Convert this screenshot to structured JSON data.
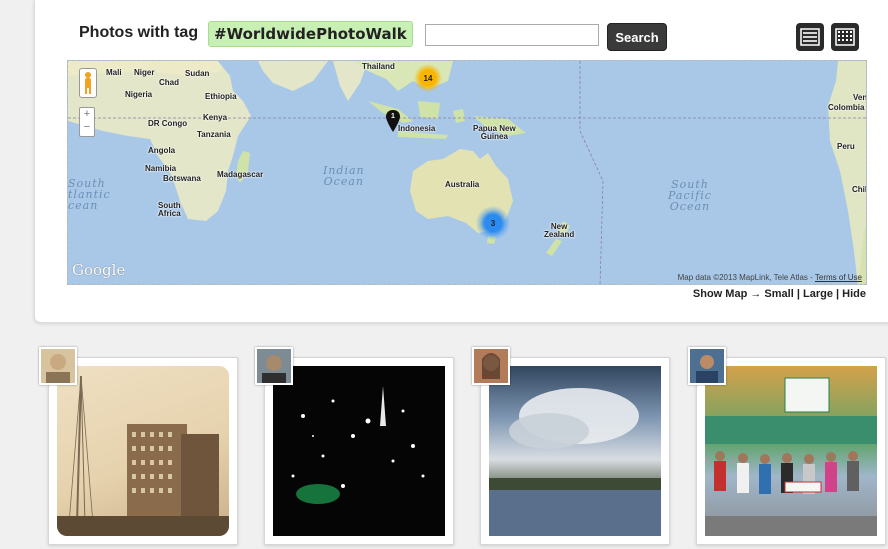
{
  "header": {
    "title": "Photos with tag",
    "tag": "#WorldwidePhotoWalk",
    "search_value": "",
    "search_label": "Search"
  },
  "map": {
    "labels": {
      "mali": "Mali",
      "niger": "Niger",
      "sudan": "Sudan",
      "chad": "Chad",
      "nigeria": "Nigeria",
      "ethiopia": "Ethiopia",
      "kenya": "Kenya",
      "drcongo": "DR Congo",
      "tanzania": "Tanzania",
      "angola": "Angola",
      "namibia": "Namibia",
      "botswana": "Botswana",
      "madagascar": "Madagascar",
      "southafrica": "South\nAfrica",
      "thailand": "Thailand",
      "indonesia": "Indonesia",
      "papua": "Papua New\nGuinea",
      "australia": "Australia",
      "newzealand": "New\nZealand",
      "venezuela": "Vene",
      "colombia": "Colombia",
      "peru": "Peru",
      "chile": "Chil"
    },
    "oceans": {
      "indian": "Indian\nOcean",
      "southatlantic": "South\ntlantic\ncean",
      "southpacific": "South\nPacific\nOcean"
    },
    "clusters": [
      {
        "count": "14",
        "color": "#f7b500"
      },
      {
        "count": "1",
        "color": "#111111"
      },
      {
        "count": "3",
        "color": "#2b8bf0"
      }
    ],
    "google": "Google",
    "data_credit": "Map data ©2013 MapLink, Tele Atlas - ",
    "terms": "Terms of Use"
  },
  "show_map": {
    "prefix": "Show Map →",
    "small": "Small",
    "large": "Large",
    "hide": "Hide",
    "sep": "|"
  },
  "icons": {
    "list": "list-view-icon",
    "grid": "grid-view-icon",
    "pegman": "pegman-icon"
  }
}
